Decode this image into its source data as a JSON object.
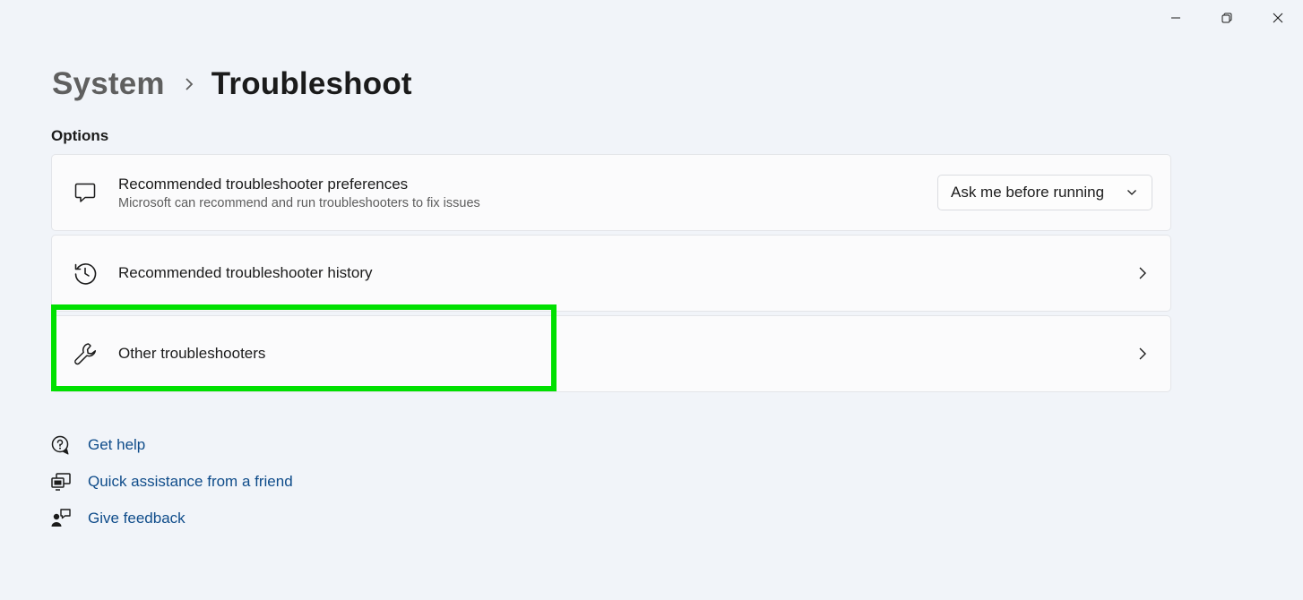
{
  "window": {
    "controls": [
      "minimize",
      "restore",
      "close"
    ]
  },
  "breadcrumb": {
    "parent": "System",
    "current": "Troubleshoot"
  },
  "section": {
    "title": "Options"
  },
  "cards": {
    "preferences": {
      "title": "Recommended troubleshooter preferences",
      "description": "Microsoft can recommend and run troubleshooters to fix issues",
      "icon": "chat-bubble-icon",
      "dropdown_value": "Ask me before running"
    },
    "history": {
      "title": "Recommended troubleshooter history",
      "icon": "history-icon"
    },
    "other": {
      "title": "Other troubleshooters",
      "icon": "wrench-icon"
    }
  },
  "help_links": [
    {
      "label": "Get help",
      "icon": "help-chat-icon"
    },
    {
      "label": "Quick assistance from a friend",
      "icon": "remote-assist-icon"
    },
    {
      "label": "Give feedback",
      "icon": "feedback-icon"
    }
  ],
  "colors": {
    "background": "#f1f4f9",
    "card": "#fbfbfc",
    "link": "#0f4c8a",
    "highlight": "#00e000"
  }
}
